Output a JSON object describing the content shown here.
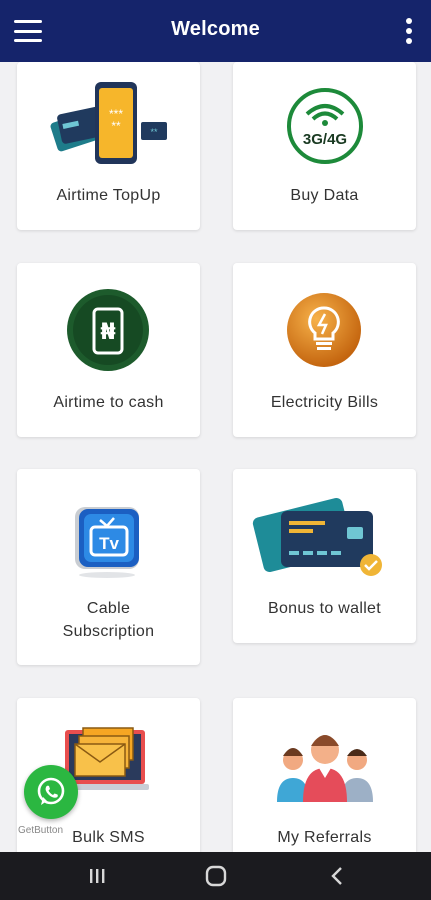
{
  "appbar": {
    "title": "Welcome",
    "menu_icon": "hamburger-menu-icon",
    "more_icon": "more-vertical-icon",
    "background": "#15246b"
  },
  "tiles": [
    {
      "label": "Airtime TopUp",
      "icon": "airtime-topup-icon"
    },
    {
      "label": "Buy Data",
      "icon": "data-3g-4g-icon",
      "icon_text": "3G/4G"
    },
    {
      "label": "Airtime to cash",
      "icon": "naira-phone-icon",
      "icon_text": "₦"
    },
    {
      "label": "Electricity Bills",
      "icon": "lightbulb-icon"
    },
    {
      "label": "Cable\nSubscription",
      "icon": "tv-icon",
      "icon_text": "Tv"
    },
    {
      "label": "Bonus to wallet",
      "icon": "bank-card-icon"
    },
    {
      "label": "Bulk SMS",
      "icon": "bulk-sms-icon"
    },
    {
      "label": "My Referrals",
      "icon": "referrals-people-icon"
    }
  ],
  "floating": {
    "whatsapp_icon": "whatsapp-icon",
    "whatsapp_color": "#2bb741",
    "getbutton_text": "GetButton"
  },
  "system_nav": {
    "recents_icon": "recents-icon",
    "home_icon": "home-icon",
    "back_icon": "back-icon"
  }
}
